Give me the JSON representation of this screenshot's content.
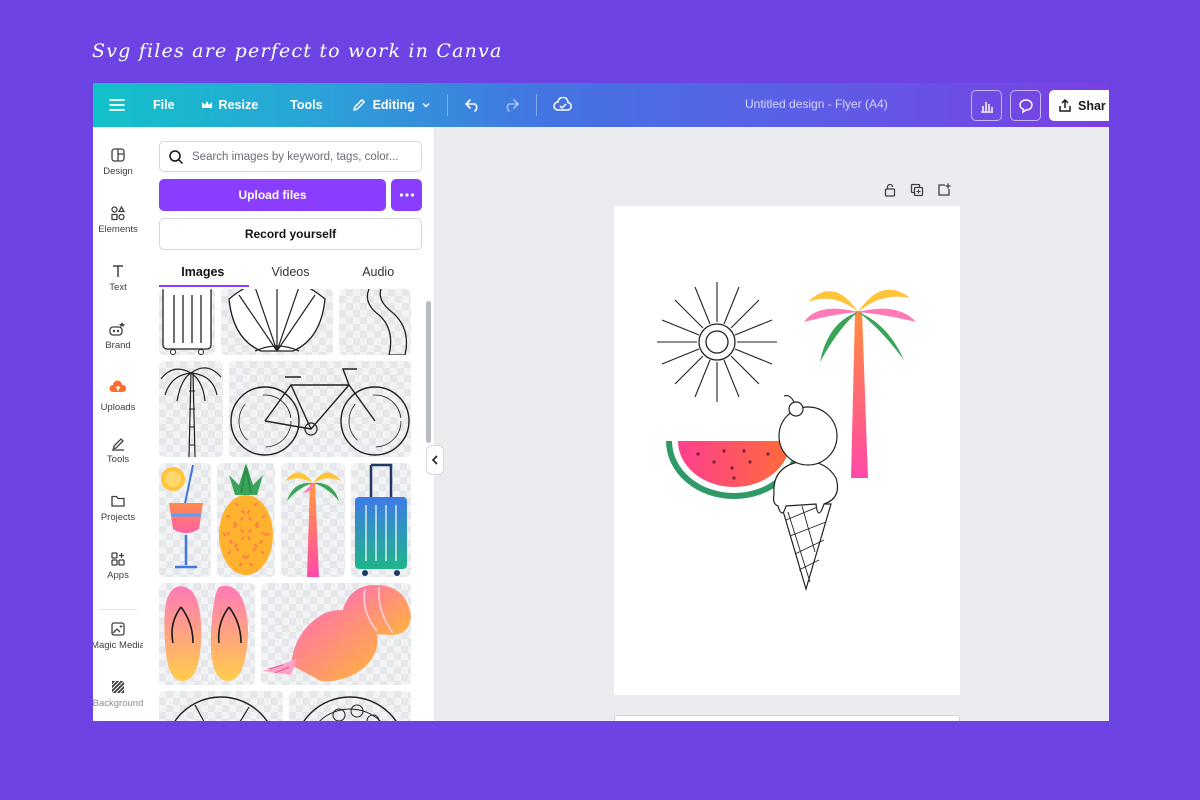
{
  "caption": "Svg files are perfect to work in Canva",
  "topbar": {
    "file_label": "File",
    "resize_label": "Resize",
    "tools_label": "Tools",
    "editing_label": "Editing",
    "title": "Untitled design - Flyer (A4)",
    "share_label": "Shar"
  },
  "rail": [
    {
      "label": "Design",
      "icon": "design-icon"
    },
    {
      "label": "Elements",
      "icon": "elements-icon"
    },
    {
      "label": "Text",
      "icon": "text-icon"
    },
    {
      "label": "Brand",
      "icon": "brand-icon"
    },
    {
      "label": "Uploads",
      "icon": "uploads-icon"
    },
    {
      "label": "Tools",
      "icon": "tools-icon"
    },
    {
      "label": "Projects",
      "icon": "projects-icon"
    },
    {
      "label": "Apps",
      "icon": "apps-icon"
    },
    {
      "label": "Magic Media",
      "icon": "magic-media-icon"
    },
    {
      "label": "Background",
      "icon": "background-icon"
    }
  ],
  "panel": {
    "search_placeholder": "Search images by keyword, tags, color...",
    "upload_label": "Upload files",
    "record_label": "Record yourself",
    "tabs": [
      "Images",
      "Videos",
      "Audio"
    ],
    "active_tab": "Images",
    "tiles": [
      "suitcase outline",
      "seashell outline",
      "road outline",
      "palm tree outline",
      "bicycle outline",
      "cocktail",
      "pineapple",
      "palm tree",
      "suitcase",
      "flip flops",
      "seashells",
      "circle outline",
      "circle outline"
    ]
  },
  "colors": {
    "background": "#6d44e3",
    "accent": "#8b3dff",
    "topbar_start": "#12c2c9",
    "topbar_end": "#7b3fe4"
  }
}
